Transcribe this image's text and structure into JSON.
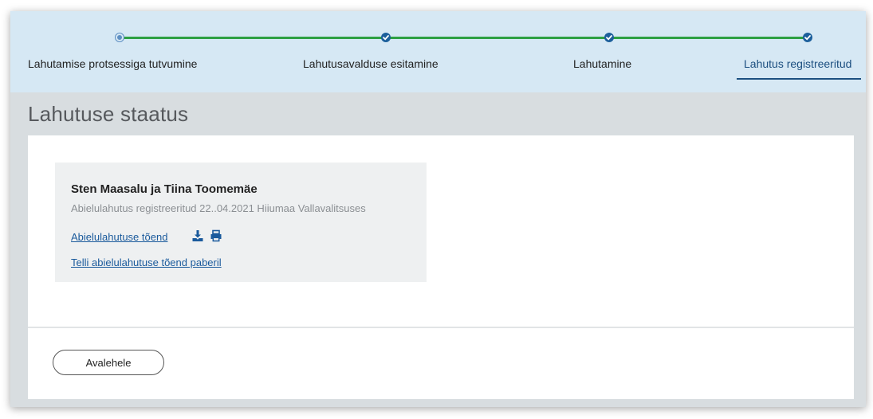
{
  "stepper": {
    "steps": [
      {
        "label": "Lahutamise protsessiga tutvumine"
      },
      {
        "label": "Lahutusavalduse esitamine"
      },
      {
        "label": "Lahutamine"
      },
      {
        "label": "Lahutus registreeritud"
      }
    ],
    "progress_color": "#2ea043"
  },
  "page": {
    "title": "Lahutuse staatus"
  },
  "record": {
    "names": "Sten Maasalu ja Tiina Toomemäe",
    "registration": "Abielulahutus registreeritud 22..04.2021 Hiiumaa Vallavalitsuses",
    "certificate_link": "Abielulahutuse tõend",
    "download_icon": "download-icon",
    "print_icon": "print-icon",
    "order_link": "Telli abielulahutuse tõend paberil"
  },
  "footer": {
    "home_button": "Avalehele"
  }
}
